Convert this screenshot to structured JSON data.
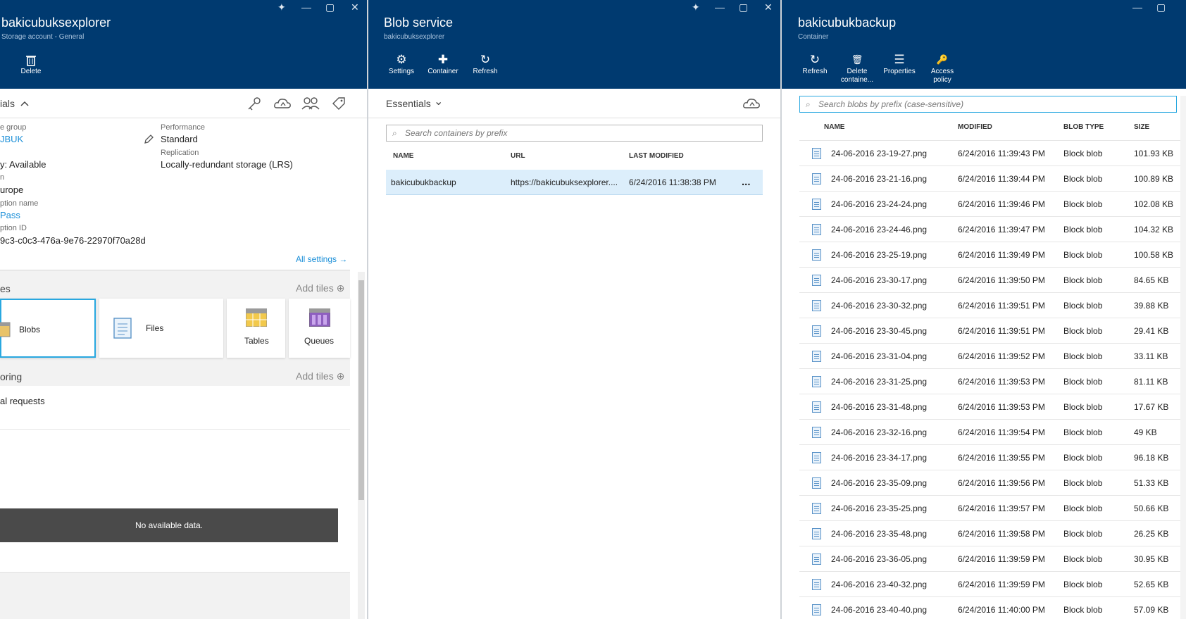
{
  "colors": {
    "header": "#003a70",
    "link": "#1b8fd8",
    "selected_row": "#dceefb"
  },
  "window_controls": {
    "pin": "✦",
    "minimize": "—",
    "maximize": "▢",
    "close": "✕"
  },
  "blade1": {
    "title": "bakicubuksexplorer",
    "subtitle": "Storage account - General",
    "commands": [
      {
        "label": "Delete",
        "icon": "trash-icon"
      }
    ],
    "essentials_label": "ials",
    "fields": {
      "resource_group_label": "e group",
      "resource_group_value": "JBUK",
      "status_value": "y: Available",
      "location_label": "n",
      "location_value": "urope",
      "subscription_name_label": "ption name",
      "subscription_name_value": "Pass",
      "subscription_id_label": "ption ID",
      "subscription_id_value": "9c3-c0c3-476a-9e76-22970f70a28d",
      "performance_label": "Performance",
      "performance_value": "Standard",
      "replication_label": "Replication",
      "replication_value": "Locally-redundant storage (LRS)"
    },
    "all_settings": "All settings →",
    "services": {
      "title": "es",
      "add_tiles": "Add tiles ⊕",
      "tiles": [
        {
          "label": "Blobs"
        },
        {
          "label": "Files"
        },
        {
          "label": "Tables"
        },
        {
          "label": "Queues"
        }
      ]
    },
    "monitoring": {
      "title": "oring",
      "add_tiles": "Add tiles ⊕",
      "requests": "al requests",
      "no_data": "No available data."
    }
  },
  "blade2": {
    "title": "Blob service",
    "subtitle": "bakicubuksexplorer",
    "commands": [
      {
        "label": "Settings",
        "icon": "⚙"
      },
      {
        "label": "Container",
        "icon": "✚"
      },
      {
        "label": "Refresh",
        "icon": "↻"
      }
    ],
    "essentials": "Essentials",
    "chevron": "⌄",
    "search_placeholder": "Search containers by prefix",
    "columns": {
      "name": "NAME",
      "url": "URL",
      "modified": "LAST MODIFIED"
    },
    "rows": [
      {
        "name": "bakicubukbackup",
        "url": "https://bakicubuksexplorer....",
        "modified": "6/24/2016 11:38:38 PM",
        "more": "..."
      }
    ]
  },
  "blade3": {
    "title": "bakicubukbackup",
    "subtitle": "Container",
    "commands": [
      {
        "label": "Refresh",
        "icon": "↻"
      },
      {
        "label": "Delete containe...",
        "icon": "🗑"
      },
      {
        "label": "Properties",
        "icon": "☰"
      },
      {
        "label": "Access policy",
        "icon": "🔑"
      }
    ],
    "search_placeholder": "Search blobs by prefix (case-sensitive)",
    "columns": {
      "name": "NAME",
      "modified": "MODIFIED",
      "type": "BLOB TYPE",
      "size": "SIZE"
    },
    "rows": [
      {
        "name": "24-06-2016 23-19-27.png",
        "modified": "6/24/2016 11:39:43 PM",
        "type": "Block blob",
        "size": "101.93 KB"
      },
      {
        "name": "24-06-2016 23-21-16.png",
        "modified": "6/24/2016 11:39:44 PM",
        "type": "Block blob",
        "size": "100.89 KB"
      },
      {
        "name": "24-06-2016 23-24-24.png",
        "modified": "6/24/2016 11:39:46 PM",
        "type": "Block blob",
        "size": "102.08 KB"
      },
      {
        "name": "24-06-2016 23-24-46.png",
        "modified": "6/24/2016 11:39:47 PM",
        "type": "Block blob",
        "size": "104.32 KB"
      },
      {
        "name": "24-06-2016 23-25-19.png",
        "modified": "6/24/2016 11:39:49 PM",
        "type": "Block blob",
        "size": "100.58 KB"
      },
      {
        "name": "24-06-2016 23-30-17.png",
        "modified": "6/24/2016 11:39:50 PM",
        "type": "Block blob",
        "size": "84.65 KB"
      },
      {
        "name": "24-06-2016 23-30-32.png",
        "modified": "6/24/2016 11:39:51 PM",
        "type": "Block blob",
        "size": "39.88 KB"
      },
      {
        "name": "24-06-2016 23-30-45.png",
        "modified": "6/24/2016 11:39:51 PM",
        "type": "Block blob",
        "size": "29.41 KB"
      },
      {
        "name": "24-06-2016 23-31-04.png",
        "modified": "6/24/2016 11:39:52 PM",
        "type": "Block blob",
        "size": "33.11 KB"
      },
      {
        "name": "24-06-2016 23-31-25.png",
        "modified": "6/24/2016 11:39:53 PM",
        "type": "Block blob",
        "size": "81.11 KB"
      },
      {
        "name": "24-06-2016 23-31-48.png",
        "modified": "6/24/2016 11:39:53 PM",
        "type": "Block blob",
        "size": "17.67 KB"
      },
      {
        "name": "24-06-2016 23-32-16.png",
        "modified": "6/24/2016 11:39:54 PM",
        "type": "Block blob",
        "size": "49 KB"
      },
      {
        "name": "24-06-2016 23-34-17.png",
        "modified": "6/24/2016 11:39:55 PM",
        "type": "Block blob",
        "size": "96.18 KB"
      },
      {
        "name": "24-06-2016 23-35-09.png",
        "modified": "6/24/2016 11:39:56 PM",
        "type": "Block blob",
        "size": "51.33 KB"
      },
      {
        "name": "24-06-2016 23-35-25.png",
        "modified": "6/24/2016 11:39:57 PM",
        "type": "Block blob",
        "size": "50.66 KB"
      },
      {
        "name": "24-06-2016 23-35-48.png",
        "modified": "6/24/2016 11:39:58 PM",
        "type": "Block blob",
        "size": "26.25 KB"
      },
      {
        "name": "24-06-2016 23-36-05.png",
        "modified": "6/24/2016 11:39:59 PM",
        "type": "Block blob",
        "size": "30.95 KB"
      },
      {
        "name": "24-06-2016 23-40-32.png",
        "modified": "6/24/2016 11:39:59 PM",
        "type": "Block blob",
        "size": "52.65 KB"
      },
      {
        "name": "24-06-2016 23-40-40.png",
        "modified": "6/24/2016 11:40:00 PM",
        "type": "Block blob",
        "size": "57.09 KB"
      }
    ]
  }
}
